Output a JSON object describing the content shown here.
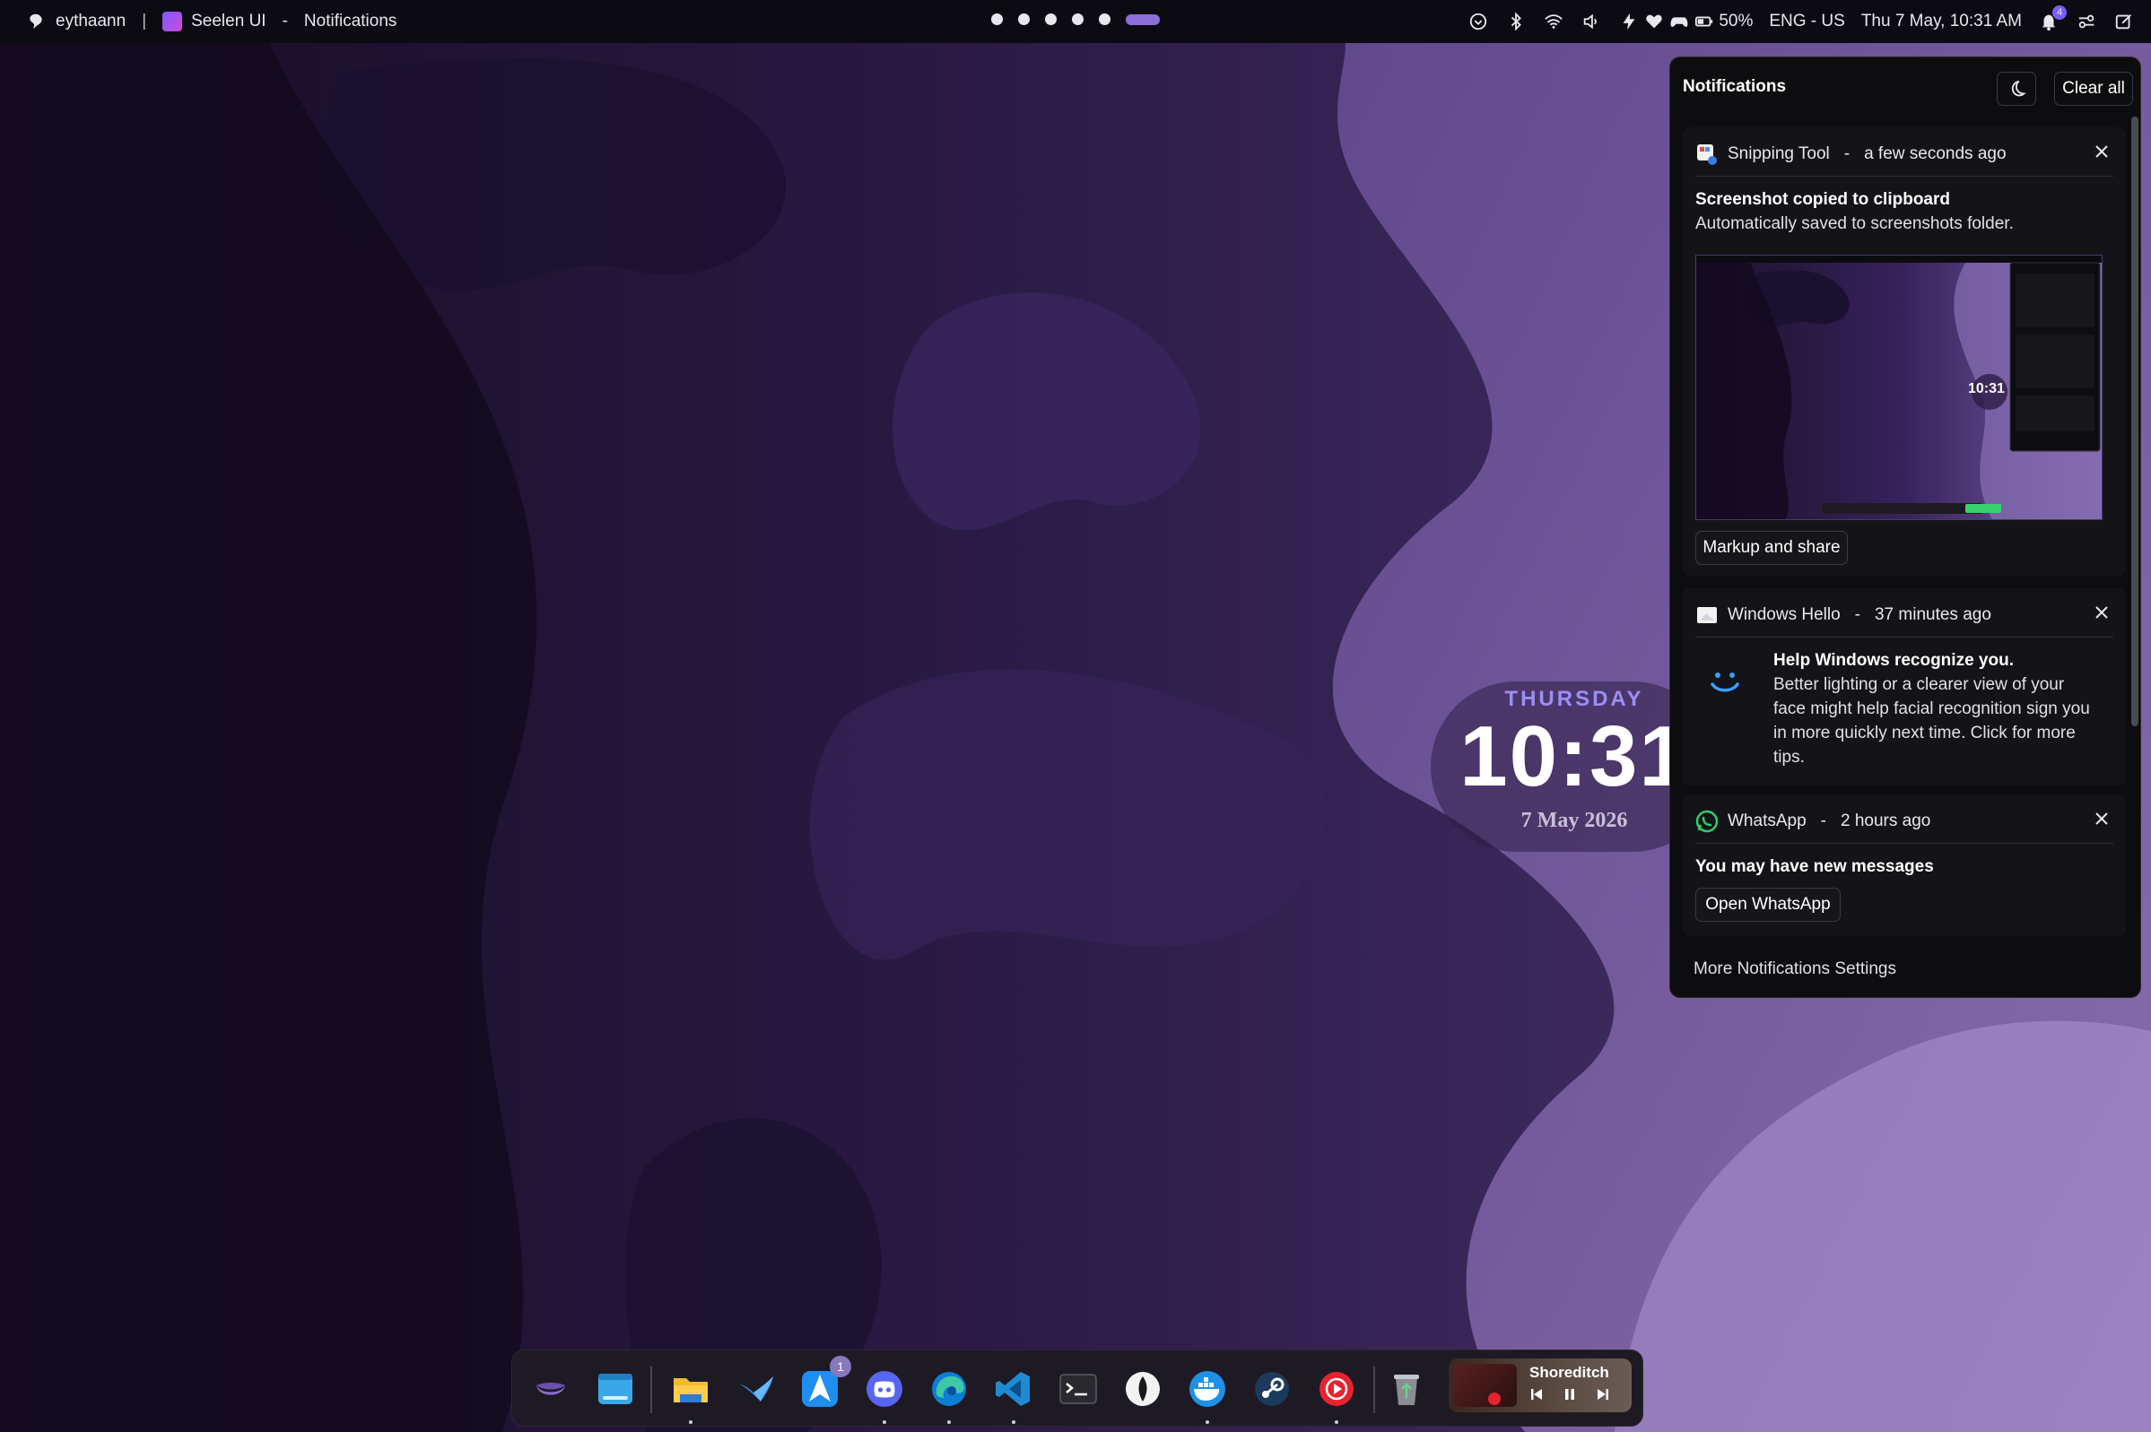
{
  "topbar": {
    "user": "eythaann",
    "separator": "|",
    "app_name": "Seelen UI",
    "dash": "-",
    "window_title": "Notifications",
    "battery": "50%",
    "language": "ENG - US",
    "datetime": "Thu 7 May, 10:31 AM",
    "notification_count": "4"
  },
  "clock": {
    "day": "THURSDAY",
    "time": "10:31",
    "date": "7 May 2026"
  },
  "notifications_panel": {
    "title": "Notifications",
    "clear_all": "Clear all",
    "more_settings": "More Notifications Settings",
    "items": [
      {
        "app": "Snipping Tool",
        "time": "a few seconds ago",
        "title": "Screenshot copied to clipboard",
        "body": "Automatically saved to screenshots folder.",
        "action": "Markup and share",
        "preview_time": "10:31"
      },
      {
        "app": "Windows Hello",
        "time": "37 minutes ago",
        "title": "Help Windows recognize you.",
        "body_lines": [
          "Better lighting or a clearer view of your",
          "face might help facial recognition sign you",
          "in more quickly next time. Click for more",
          "tips."
        ]
      },
      {
        "app": "WhatsApp",
        "time": "2 hours ago",
        "title": "You may have new messages",
        "action": "Open WhatsApp"
      }
    ]
  },
  "dock": {
    "badge_count": "1",
    "media_title": "Shoreditch"
  },
  "colors": {
    "accent": "#8b6fd8",
    "clock_day": "#9a8ff5",
    "panel_bg": "#0d0d10"
  }
}
